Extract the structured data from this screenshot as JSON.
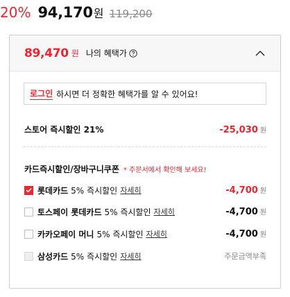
{
  "price": {
    "discount_rate": "20%",
    "sale_price": "94,170",
    "sale_unit": "원",
    "original_price": "119,200"
  },
  "benefit": {
    "my_price": "89,470",
    "my_price_unit": "원",
    "my_price_label": "나의 혜택가",
    "login_notice": {
      "link": "로그인",
      "message": "하시면 더 정확한 혜택가를 알 수 있어요!"
    },
    "store_discount": {
      "label": "스토어 즉시할인 21%",
      "amount": "-25,030",
      "unit": "원"
    },
    "card_section": {
      "title": "카드즉시할인/장바구니쿠폰",
      "note": "* 주문서에서 확인해 보세요!",
      "items": [
        {
          "name": "롯데카드",
          "rate": "5% 즉시할인",
          "detail": "자세히",
          "amount": "-4,700",
          "unit": "원",
          "checked": true
        },
        {
          "name": "토스페이 롯데카드",
          "rate": "5% 즉시할인",
          "detail": "자세히",
          "amount": "-4,700",
          "unit": "원",
          "checked": false
        },
        {
          "name": "카카오페이 머니",
          "rate": "5% 즉시할인",
          "detail": "자세히",
          "amount": "-4,700",
          "unit": "원",
          "checked": false
        },
        {
          "name": "삼성카드",
          "rate": "5% 즉시할인",
          "detail": "자세히",
          "status": "주문금액부족",
          "disabled": true
        }
      ]
    }
  },
  "colors": {
    "accent": "#f0242f",
    "muted": "#888888",
    "border": "#cfcfcf"
  }
}
